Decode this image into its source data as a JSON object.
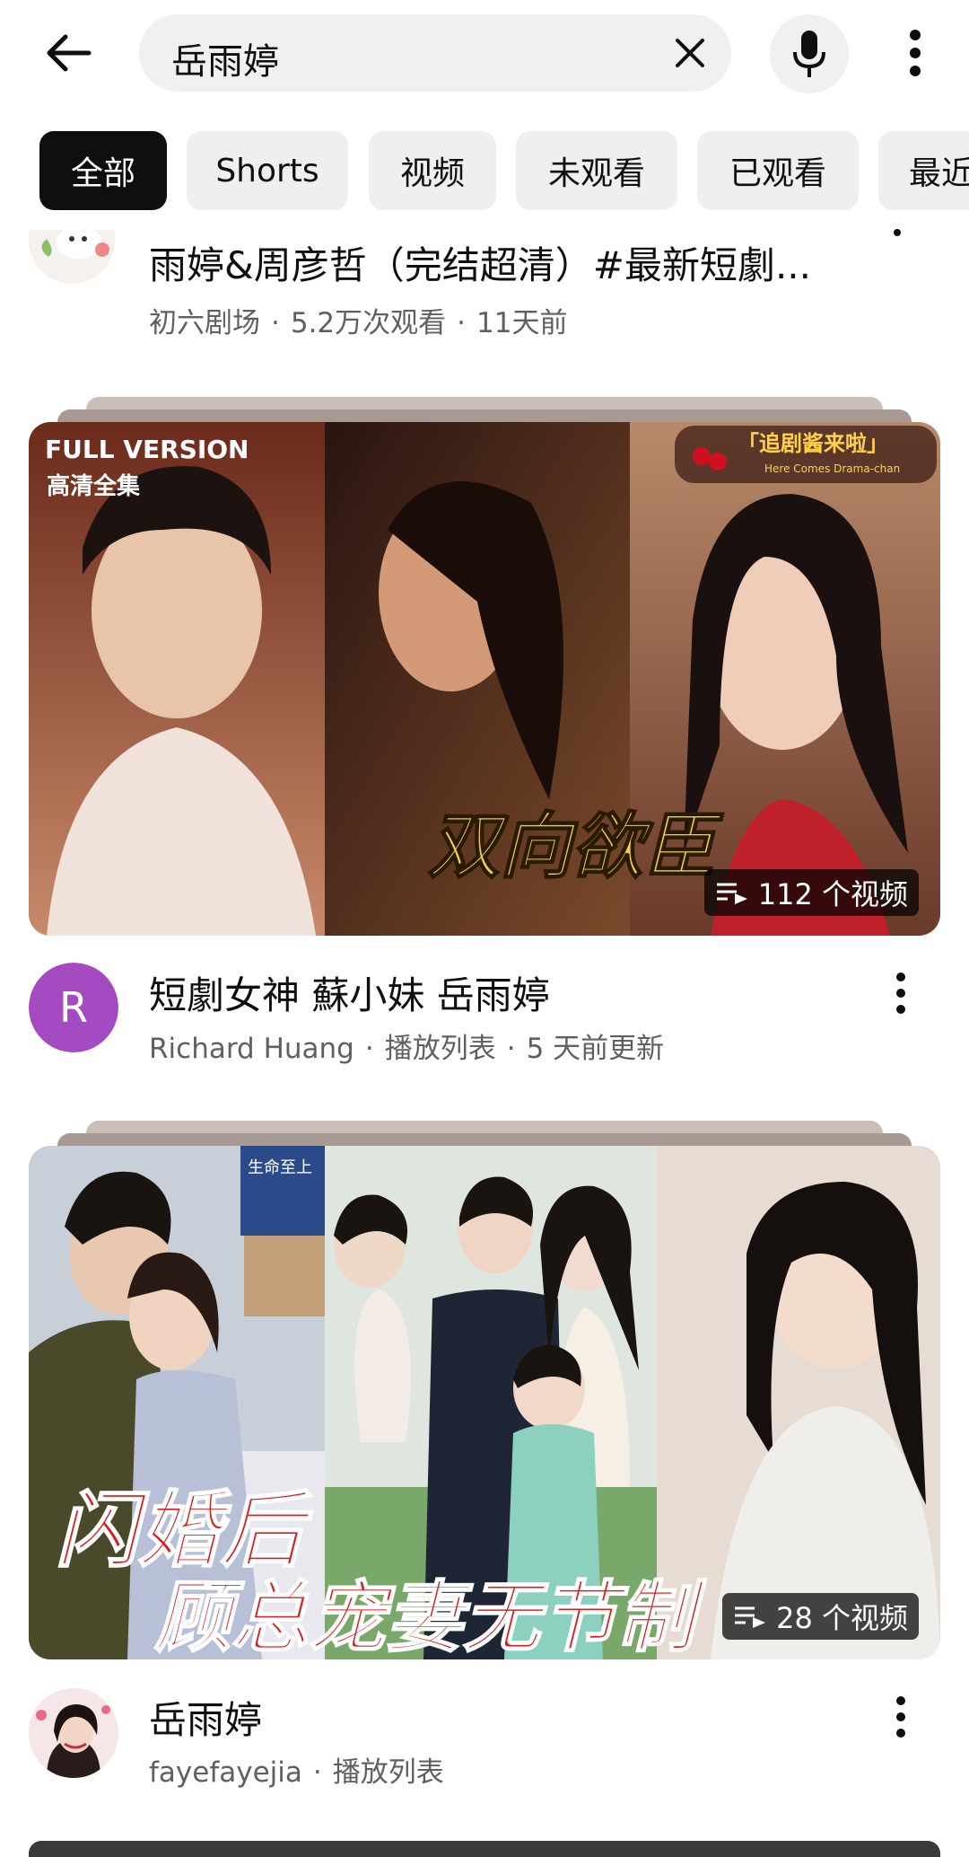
{
  "search": {
    "query": "岳雨婷"
  },
  "chips": [
    {
      "label": "全部",
      "active": true
    },
    {
      "label": "Shorts",
      "active": false
    },
    {
      "label": "视频",
      "active": false
    },
    {
      "label": "未观看",
      "active": false
    },
    {
      "label": "已观看",
      "active": false
    },
    {
      "label": "最近",
      "active": false
    }
  ],
  "row1": {
    "title": "雨婷&周彦哲（完结超清）#最新短劇...",
    "channel": "初六剧场",
    "views": "5.2万次观看",
    "age": "11天前"
  },
  "playlists": [
    {
      "title": "短劇女神 蘇小妹 岳雨婷",
      "channel": "Richard Huang",
      "type": "播放列表",
      "updated": "5 天前更新",
      "count": "112 个视频",
      "avatar_letter": "R",
      "avatar_color": "#a54bc1",
      "thumb_overlay_top_left": "FULL VERSION",
      "thumb_overlay_sub": "高清全集",
      "thumb_overlay_brand": "「追剧酱来啦」",
      "thumb_overlay_brand_sub": "Here Comes Drama-chan",
      "thumb_overlay_title": "双向欲臣"
    },
    {
      "title": "岳雨婷",
      "channel": "fayefayejia",
      "type": "播放列表",
      "count": "28 个视频",
      "thumb_overlay_title_1": "闪婚后",
      "thumb_overlay_title_2": "顾总宠妻无节制",
      "thumb_sign_text": "生命至上"
    }
  ]
}
